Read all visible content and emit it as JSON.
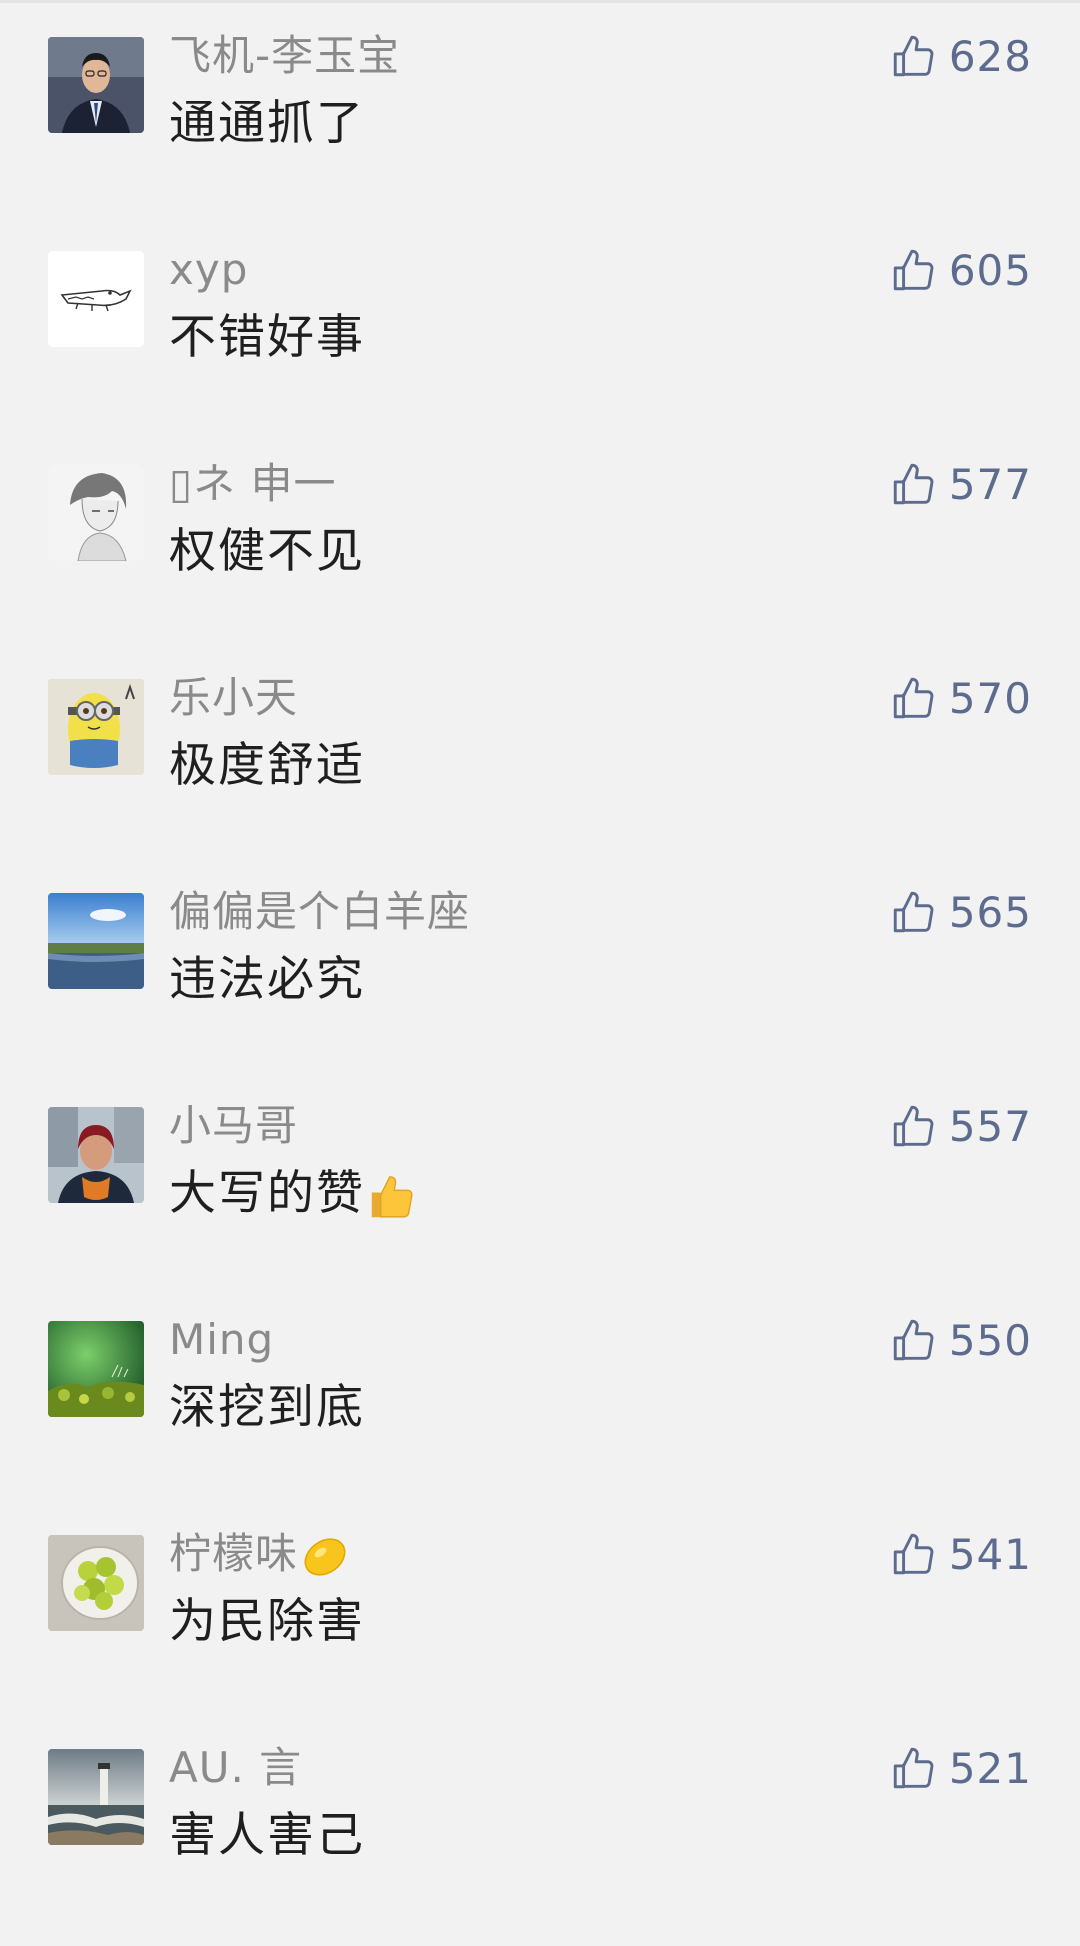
{
  "comments": [
    {
      "name": "飞机-李玉宝",
      "text": "通通抓了",
      "likes": "628",
      "avatar": "man-in-suit-photo"
    },
    {
      "name": "xyp",
      "text": "不错好事",
      "likes": "605",
      "avatar": "crocodile-drawing"
    },
    {
      "name": "▯ネ 申一",
      "text": "权健不见",
      "likes": "577",
      "avatar": "anime-boy-sketch"
    },
    {
      "name": "乐小天",
      "text": "极度舒适",
      "likes": "570",
      "avatar": "minion-drawing"
    },
    {
      "name": "偏偏是个白羊座",
      "text": "违法必究",
      "likes": "565",
      "avatar": "lake-sky-photo"
    },
    {
      "name": "小马哥",
      "text": "大写的赞",
      "likes": "557",
      "avatar": "woman-selfie-photo",
      "text_emoji": "thumbs-up-emoji"
    },
    {
      "name": "Ming",
      "text": "深挖到底",
      "likes": "550",
      "avatar": "green-moss-photo"
    },
    {
      "name": "柠檬味",
      "text": "为民除害",
      "likes": "541",
      "avatar": "succulent-bowl-photo",
      "name_emoji": "lemon-emoji"
    },
    {
      "name": "AU. 言",
      "text": "害人害己",
      "likes": "521",
      "avatar": "lighthouse-sea-photo"
    }
  ],
  "colors": {
    "background": "#f2f2f2",
    "name": "#8a8a8a",
    "comment": "#1f1f1f",
    "like": "#5d6c8e"
  }
}
